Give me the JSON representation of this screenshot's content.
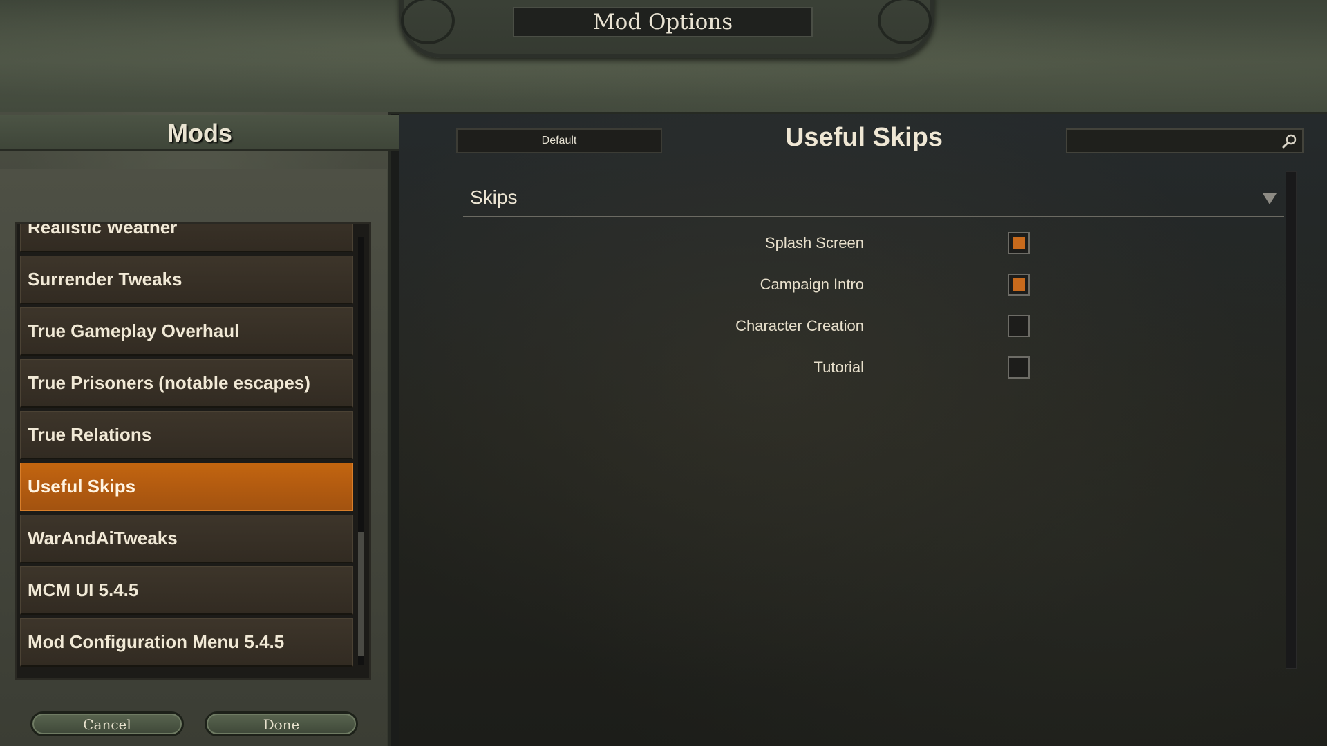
{
  "header": {
    "title": "Mod Options"
  },
  "mods_panel": {
    "title": "Mods",
    "items": [
      {
        "label": "Realistic Weather",
        "selected": false
      },
      {
        "label": "Surrender Tweaks",
        "selected": false
      },
      {
        "label": "True Gameplay Overhaul",
        "selected": false
      },
      {
        "label": "True Prisoners (notable escapes)",
        "selected": false
      },
      {
        "label": "True Relations",
        "selected": false
      },
      {
        "label": "Useful Skips",
        "selected": true
      },
      {
        "label": "WarAndAiTweaks",
        "selected": false
      },
      {
        "label": "MCM UI 5.4.5",
        "selected": false
      },
      {
        "label": "Mod Configuration Menu 5.4.5",
        "selected": false
      }
    ]
  },
  "footer": {
    "cancel_label": "Cancel",
    "done_label": "Done"
  },
  "settings_panel": {
    "default_label": "Default",
    "mod_title": "Useful Skips",
    "search": {
      "value": "",
      "placeholder": ""
    },
    "group": {
      "label": "Skips",
      "settings": [
        {
          "label": "Splash Screen",
          "checked": true
        },
        {
          "label": "Campaign Intro",
          "checked": true
        },
        {
          "label": "Character Creation",
          "checked": false
        },
        {
          "label": "Tutorial",
          "checked": false
        }
      ]
    }
  },
  "colors": {
    "accent": "#c86a1c",
    "selected_item": "#b65d10"
  }
}
